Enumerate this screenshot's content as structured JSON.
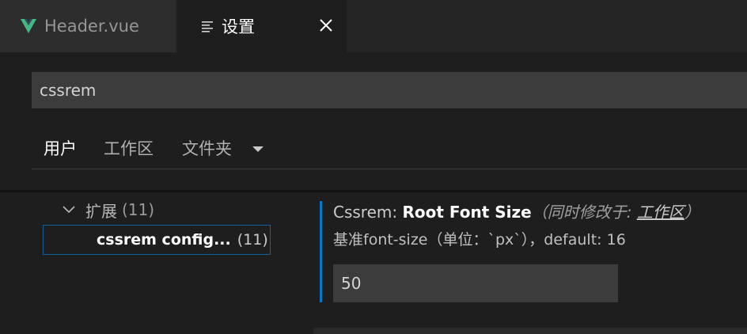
{
  "tabs": {
    "inactive_label": "Header.vue",
    "active_label": "设置",
    "vue_icon_color": "#42b883"
  },
  "search": {
    "value": "cssrem"
  },
  "scope_tabs": {
    "user": "用户",
    "workspace": "工作区",
    "folder": "文件夹"
  },
  "toc": {
    "group_label": "扩展",
    "group_count": "(11)",
    "item_label": "cssrem config...",
    "item_count": "(11)"
  },
  "setting": {
    "prefix": "Cssrem: ",
    "key": "Root Font Size",
    "modified_prefix": "（同时修改于: ",
    "modified_link": "工作区",
    "modified_suffix": "）",
    "description": "基准font-size（单位：`px`），default: 16",
    "value": "50"
  },
  "colors": {
    "accent": "#007acc",
    "background": "#1e1e1e"
  }
}
